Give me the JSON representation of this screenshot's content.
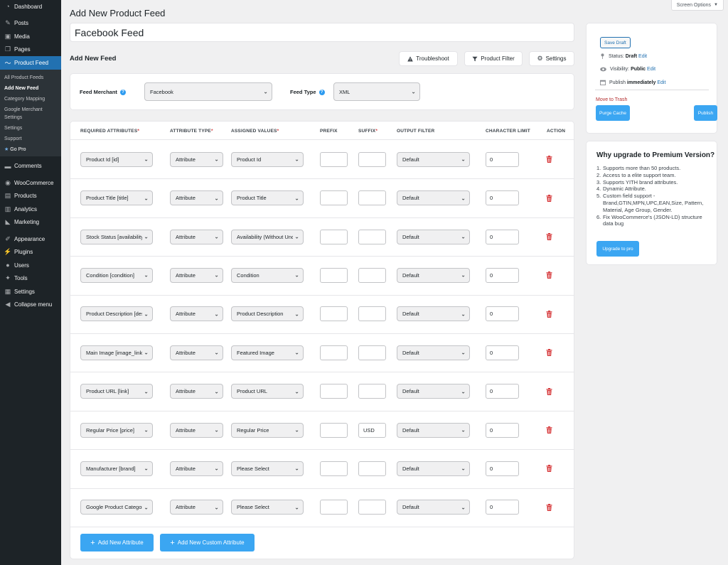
{
  "sidebar": {
    "menu_top": [
      {
        "label": "Dashboard",
        "icon": "dashboard-icon"
      },
      {
        "label": "Posts",
        "icon": "pin-icon"
      },
      {
        "label": "Media",
        "icon": "media-icon"
      },
      {
        "label": "Pages",
        "icon": "pages-icon"
      },
      {
        "label": "Product Feed",
        "icon": "chart-line-icon"
      }
    ],
    "submenu": [
      "All Product Feeds",
      "Add New Feed",
      "Category Mapping",
      "Google Merchant Settings",
      "Settings",
      "Support",
      "Go Pro"
    ],
    "menu_bottom": [
      {
        "label": "Comments",
        "icon": "comment-icon"
      },
      {
        "label": "WooCommerce",
        "icon": "woo-icon"
      },
      {
        "label": "Products",
        "icon": "products-icon"
      },
      {
        "label": "Analytics",
        "icon": "analytics-icon"
      },
      {
        "label": "Marketing",
        "icon": "megaphone-icon"
      },
      {
        "label": "Appearance",
        "icon": "brush-icon"
      },
      {
        "label": "Plugins",
        "icon": "plugin-icon"
      },
      {
        "label": "Users",
        "icon": "users-icon"
      },
      {
        "label": "Tools",
        "icon": "wrench-icon"
      },
      {
        "label": "Settings",
        "icon": "settings-icon"
      },
      {
        "label": "Collapse menu",
        "icon": "collapse-icon"
      }
    ]
  },
  "screen_options": "Screen Options",
  "page_title": "Add New Product Feed",
  "feed_title_value": "Facebook Feed",
  "section_title": "Add New Feed",
  "toolbar": {
    "troubleshoot": "Troubleshoot",
    "product_filter": "Product Filter",
    "settings": "Settings"
  },
  "merchant": {
    "label": "Feed Merchant",
    "value": "Facebook"
  },
  "feed_type": {
    "label": "Feed Type",
    "value": "XML"
  },
  "table": {
    "headers": {
      "required": "REQUIRED ATTRIBUTES",
      "type": "ATTRIBUTE TYPE",
      "assigned": "ASSIGNED VALUES",
      "prefix": "PREFIX",
      "suffix": "SUFFIX",
      "filter": "OUTPUT FILTER",
      "limit": "CHARACTER LIMIT",
      "action": "ACTION"
    },
    "rows": [
      {
        "attr": "Product Id [id]",
        "type": "Attribute",
        "value": "Product Id",
        "prefix": "",
        "suffix": "",
        "filter": "Default",
        "limit": "0"
      },
      {
        "attr": "Product Title [title]",
        "type": "Attribute",
        "value": "Product Title",
        "prefix": "",
        "suffix": "",
        "filter": "Default",
        "limit": "0"
      },
      {
        "attr": "Stock Status [availability]",
        "type": "Attribute",
        "value": "Availability (Without Underscore)",
        "prefix": "",
        "suffix": "",
        "filter": "Default",
        "limit": "0"
      },
      {
        "attr": "Condition [condition]",
        "type": "Attribute",
        "value": "Condition",
        "prefix": "",
        "suffix": "",
        "filter": "Default",
        "limit": "0"
      },
      {
        "attr": "Product Description [description]",
        "type": "Attribute",
        "value": "Product Description",
        "prefix": "",
        "suffix": "",
        "filter": "Default",
        "limit": "0"
      },
      {
        "attr": "Main Image [image_link]",
        "type": "Attribute",
        "value": "Featured Image",
        "prefix": "",
        "suffix": "",
        "filter": "Default",
        "limit": "0"
      },
      {
        "attr": "Product URL [link]",
        "type": "Attribute",
        "value": "Product URL",
        "prefix": "",
        "suffix": "",
        "filter": "Default",
        "limit": "0"
      },
      {
        "attr": "Regular Price [price]",
        "type": "Attribute",
        "value": "Regular Price",
        "prefix": "",
        "suffix": "USD",
        "filter": "Default",
        "limit": "0"
      },
      {
        "attr": "Manufacturer [brand]",
        "type": "Attribute",
        "value": "Please Select",
        "prefix": "",
        "suffix": "",
        "filter": "Default",
        "limit": "0"
      },
      {
        "attr": "Google Product Category",
        "type": "Attribute",
        "value": "Please Select",
        "prefix": "",
        "suffix": "",
        "filter": "Default",
        "limit": "0"
      }
    ],
    "add_attribute": "Add New Attribute",
    "add_custom_attribute": "Add New Custom Attribute"
  },
  "publish": {
    "save_draft": "Save Draft",
    "status_label": "Status:",
    "status_value": "Draft",
    "edit": "Edit",
    "visibility_label": "Visibility:",
    "visibility_value": "Public",
    "publish_label": "Publish",
    "publish_value": "immediately",
    "trash": "Move to Trash",
    "purge_cache": "Purge Cache",
    "publish_button": "Publish"
  },
  "upgrade": {
    "title": "Why upgrade to Premium Version?",
    "items": [
      "Supports more than 50 products.",
      "Access to a elite support team.",
      "Supports YITH brand attributes.",
      "Dynamic Attribute.",
      "Custom field support - Brand,GTIN,MPN,UPC,EAN,Size, Pattern, Material, Age Group, Gender.",
      "Fix WooCommerce's (JSON-LD) structure data bug"
    ],
    "button": "Upgrade to pro"
  },
  "colors": {
    "accent": "#3ba6f2",
    "wp_blue": "#2271b1",
    "sidebar": "#1d2327",
    "danger": "#d63638"
  }
}
